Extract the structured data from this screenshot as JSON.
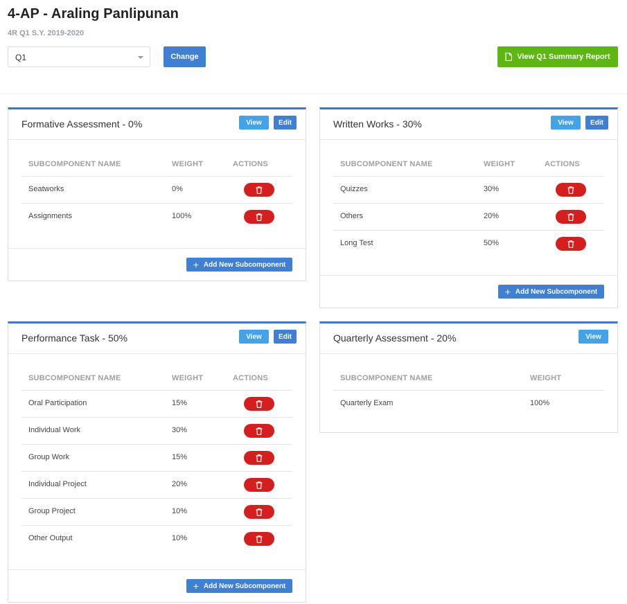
{
  "header": {
    "title": "4-AP - Araling Panlipunan",
    "subtitle": "4R Q1 S.Y. 2019-2020",
    "quarter_select": {
      "value": "Q1",
      "options": [
        "Q1"
      ]
    },
    "change_label": "Change",
    "summary_label": "View Q1 Summary Report"
  },
  "table_headers": {
    "name": "SUBCOMPONENT NAME",
    "weight": "WEIGHT",
    "actions": "ACTIONS"
  },
  "buttons": {
    "view": "View",
    "edit": "Edit",
    "add_subcomponent": "Add New Subcomponent"
  },
  "cards": [
    {
      "title": "Formative Assessment - 0%",
      "rows": [
        {
          "name": "Seatworks",
          "weight": "0%"
        },
        {
          "name": "Assignments",
          "weight": "100%"
        }
      ]
    },
    {
      "title": "Written Works - 30%",
      "rows": [
        {
          "name": "Quizzes",
          "weight": "30%"
        },
        {
          "name": "Others",
          "weight": "20%"
        },
        {
          "name": "Long Test",
          "weight": "50%"
        }
      ]
    },
    {
      "title": "Performance Task - 50%",
      "rows": [
        {
          "name": "Oral Participation",
          "weight": "15%"
        },
        {
          "name": "Individual Work",
          "weight": "30%"
        },
        {
          "name": "Group Work",
          "weight": "15%"
        },
        {
          "name": "Individual Project",
          "weight": "20%"
        },
        {
          "name": "Group Project",
          "weight": "10%"
        },
        {
          "name": "Other Output",
          "weight": "10%"
        }
      ]
    },
    {
      "title": "Quarterly Assessment - 20%",
      "rows": [
        {
          "name": "Quarterly Exam",
          "weight": "100%"
        }
      ]
    }
  ],
  "colors": {
    "primary": "#3f7fd4",
    "info": "#44a3e8",
    "success": "#5cb811",
    "danger": "#d51f1f"
  },
  "icons": {
    "delete": "trash-icon",
    "add": "plus-icon",
    "report": "document-icon",
    "dropdown": "chevron-down-icon"
  }
}
